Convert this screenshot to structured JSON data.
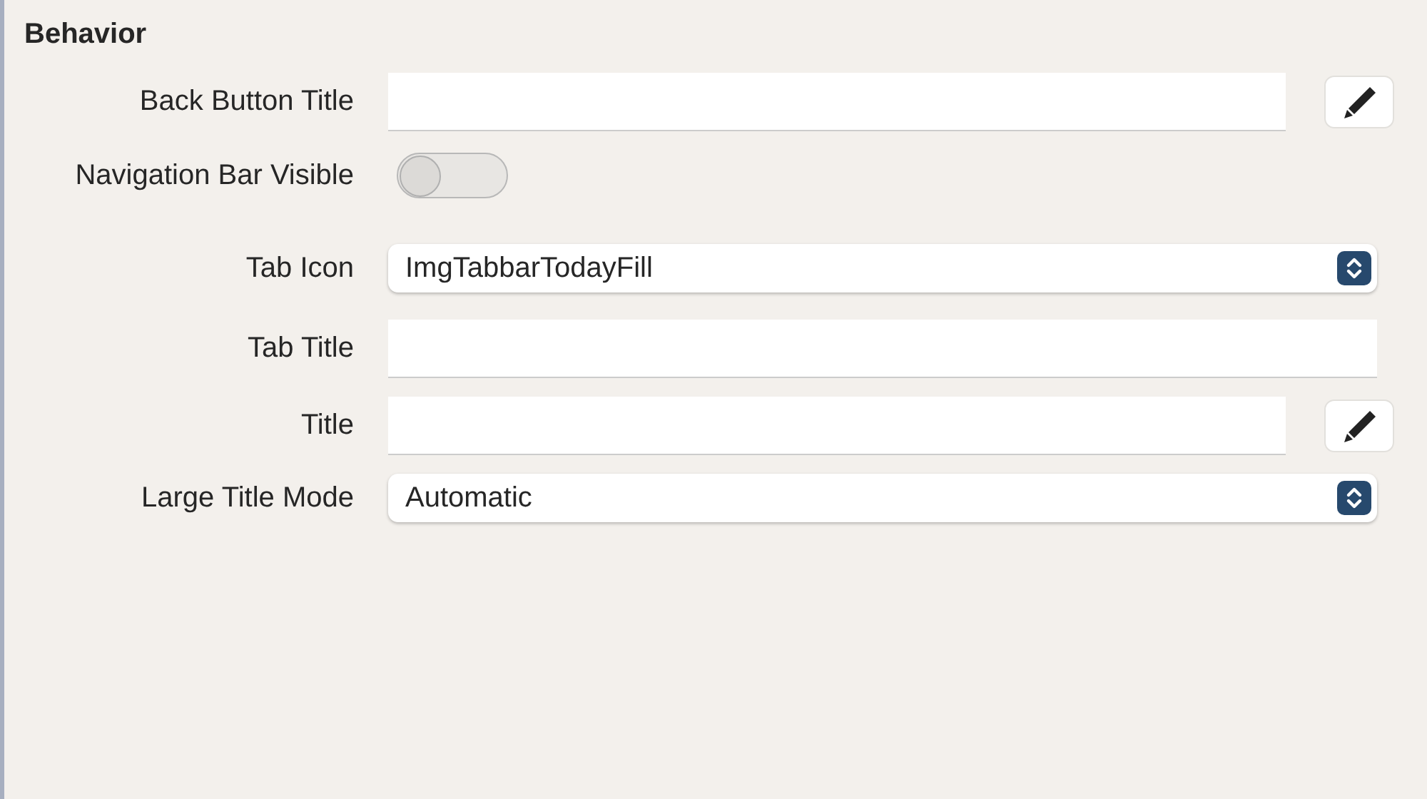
{
  "section": {
    "title": "Behavior"
  },
  "rows": [
    {
      "kind": "text",
      "label": "Back Button Title",
      "edit_button": true
    },
    {
      "kind": "toggle",
      "label": "Navigation Bar Visible",
      "on": false
    },
    {
      "kind": "popup",
      "label": "Tab Icon",
      "value": "ImgTabbarTodayFill"
    },
    {
      "kind": "text",
      "label": "Tab Title",
      "edit_button": false
    },
    {
      "kind": "text",
      "label": "Title",
      "edit_button": true
    },
    {
      "kind": "popup",
      "label": "Large Title Mode",
      "value": "Automatic"
    }
  ]
}
